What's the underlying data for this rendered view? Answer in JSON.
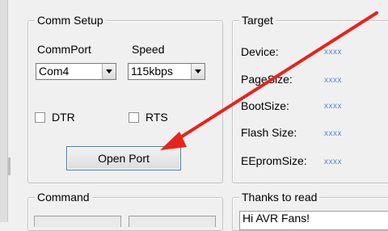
{
  "comm_setup": {
    "title": "Comm Setup",
    "commport_label": "CommPort",
    "commport_value": "Com4",
    "speed_label": "Speed",
    "speed_value": "115kbps",
    "dtr_label": "DTR",
    "dtr_checked": false,
    "rts_label": "RTS",
    "rts_checked": false,
    "open_port_label": "Open Port"
  },
  "target": {
    "title": "Target",
    "rows": [
      {
        "label": "Device:",
        "value": "xxxx"
      },
      {
        "label": "PageSize:",
        "value": "xxxx"
      },
      {
        "label": "BootSize:",
        "value": "xxxx"
      },
      {
        "label": "Flash Size:",
        "value": "xxxx"
      },
      {
        "label": "EEpromSize:",
        "value": "xxxx"
      }
    ]
  },
  "command": {
    "title": "Command"
  },
  "thanks": {
    "title": "Thanks to read",
    "text": "Hi AVR Fans!"
  },
  "annotation": {
    "arrow_color": "#e8231c"
  }
}
